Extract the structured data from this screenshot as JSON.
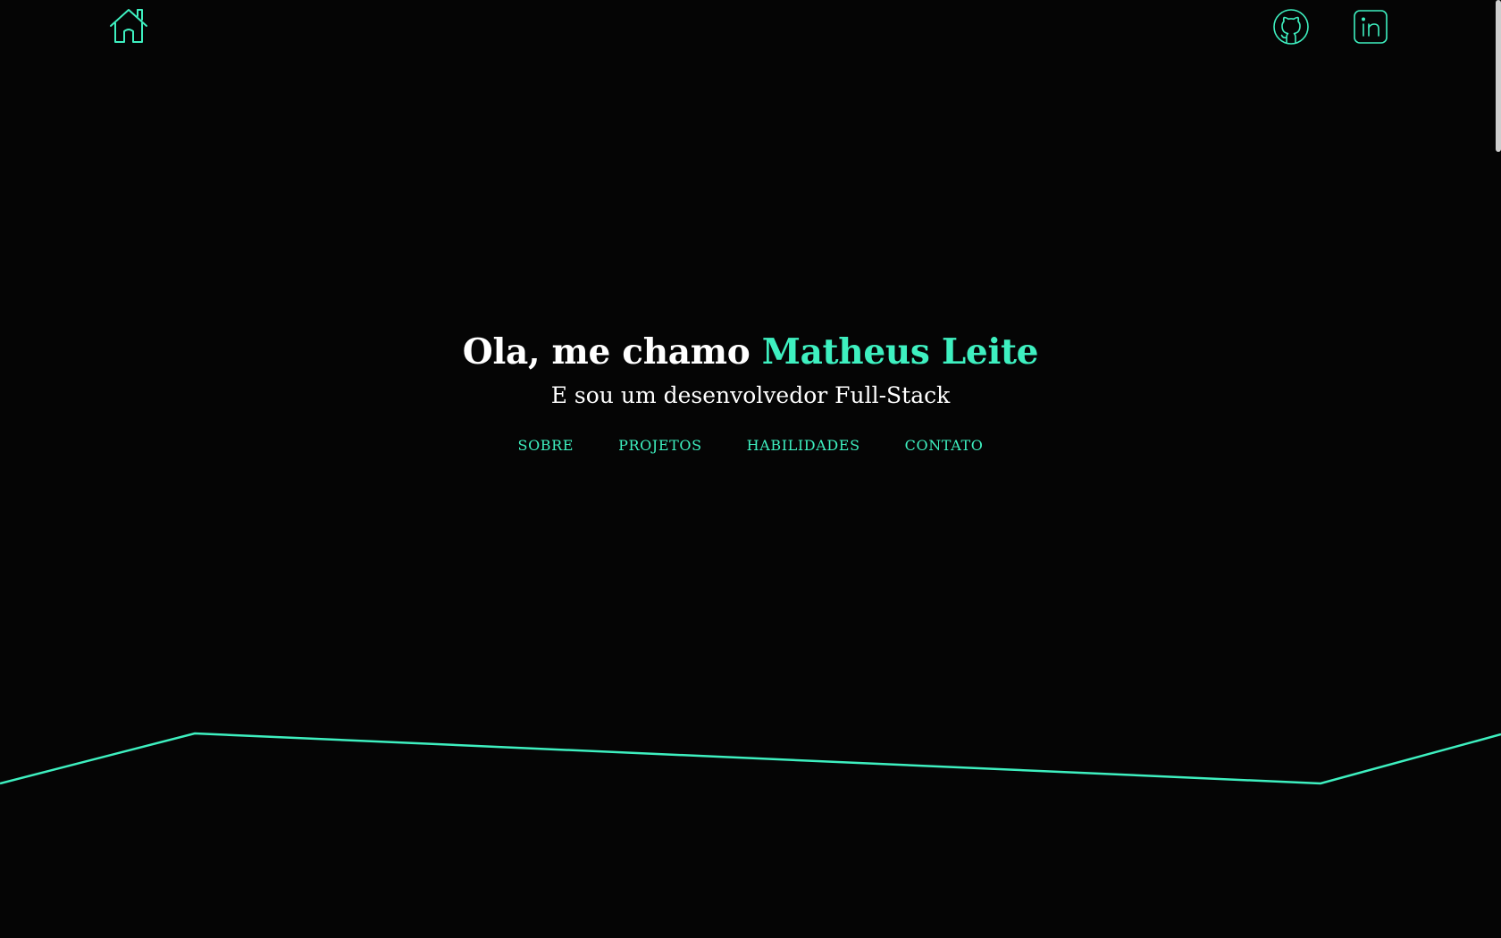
{
  "colors": {
    "background": "#050505",
    "accent": "#3ef0c0",
    "text": "#ffffff"
  },
  "topbar": {
    "home_icon": "home-icon",
    "github_icon": "github-icon",
    "linkedin_icon": "linkedin-icon"
  },
  "hero": {
    "greeting": "Ola, me chamo ",
    "name": "Matheus Leite",
    "subtitle": "E sou um desenvolvedor Full-Stack"
  },
  "nav": {
    "items": [
      {
        "label": "SOBRE"
      },
      {
        "label": "PROJETOS"
      },
      {
        "label": "HABILIDADES"
      },
      {
        "label": "CONTATO"
      }
    ]
  }
}
